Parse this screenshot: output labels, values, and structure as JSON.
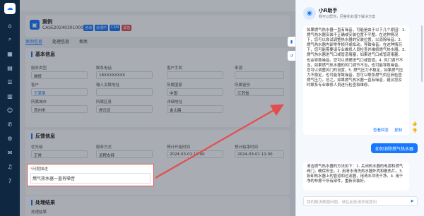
{
  "sidebar": {
    "icons": [
      "home-icon",
      "search-icon",
      "grid-icon",
      "doc-icon",
      "list-icon",
      "chart-icon",
      "user-icon",
      "phone-icon",
      "settings-icon",
      "mail-icon",
      "bell-icon",
      "help-icon"
    ]
  },
  "case": {
    "title": "案例",
    "id": "CASE202403010001",
    "tags": [
      "咨询",
      "处理中",
      "CRM",
      "紧急"
    ]
  },
  "tabs": [
    "案例信息",
    "处理信息",
    "相关"
  ],
  "basic": {
    "title": "基本信息",
    "fields": [
      {
        "label": "服务类型",
        "value": "维修"
      },
      {
        "label": "联系电话",
        "value": "18XXXXXXXX"
      },
      {
        "label": "客户手机",
        "value": ""
      },
      {
        "label": "来源",
        "value": ""
      },
      {
        "label": "客户",
        "value": "王某某"
      },
      {
        "label": "输入关联地址",
        "value": ""
      },
      {
        "label": "所属国家",
        "value": "中国"
      },
      {
        "label": "所属省份",
        "value": "江苏省"
      },
      {
        "label": "所属城市",
        "value": "苏州市"
      },
      {
        "label": "所属区县",
        "value": "虎丘区"
      },
      {
        "label": "详细地址",
        "value": "金山路"
      }
    ],
    "phone2": "18XXXXXXXX"
  },
  "feedback": {
    "title": "反馈信息",
    "priority_label": "优先级",
    "priority": "正常",
    "method_label": "服务方式",
    "method": "远程支持",
    "start_label": "预计开始时间",
    "start": "2024-03-01 11:00",
    "end_label": "预计结束时间",
    "end": "2024-03-01 11:00",
    "desc_label": "问题描述",
    "desc": "燃气热水器一直有噪音"
  },
  "result": {
    "title": "处理结果",
    "sub": "处理结果"
  },
  "assistant": {
    "name": "小R助手",
    "subtitle": "我可以帮你，回答和处理下解决方案",
    "answer": "如果燃气热水器一直有噪音，可能是由于以下几个原因：1. 燃气热水器安装不正确或安装位置不平整。在这种情况下，您可以尝试调整热水器的安装位置，以消除噪音。2. 燃气热水器内部零件损坏或松动，导致噪音。在这种情况下，您可能需要请专业维修人员检查并维修燃气热水器。3. 燃气热水器进气口或管道堵塞，如果进气口或管道堵塞，也会导致噪音。您可以清理进气口或管道。4. 风门调节不当，如果燃气热水器的风门调节不当，也可能导致噪音。您可以调整风门的设置。5. 燃气压力不稳定，如果燃气压力不稳定，也可能导致噪音。您可以联系燃气供应商检查燃气压力。总之，如果燃气热水器一直有噪音，建议您及时联系专业维修人员进行检查和维修。",
    "ref_label": "查看回答",
    "copy_label": "复制",
    "user_message": "如何消除燃气热水器",
    "answer2": "清洁燃气热水器的方法如下：1. 关闭热水器的电源和燃气阀门，确保安全。2. 用清水清洗热水器外壳和散热片。3. 拆卸热水器上的管道和过滤器，用清水冲洗干净。4. 用干净的布擦干所有部件，重新安装好。",
    "input_placeholder": "我的解决数据问题，请在此处请求或提问"
  }
}
